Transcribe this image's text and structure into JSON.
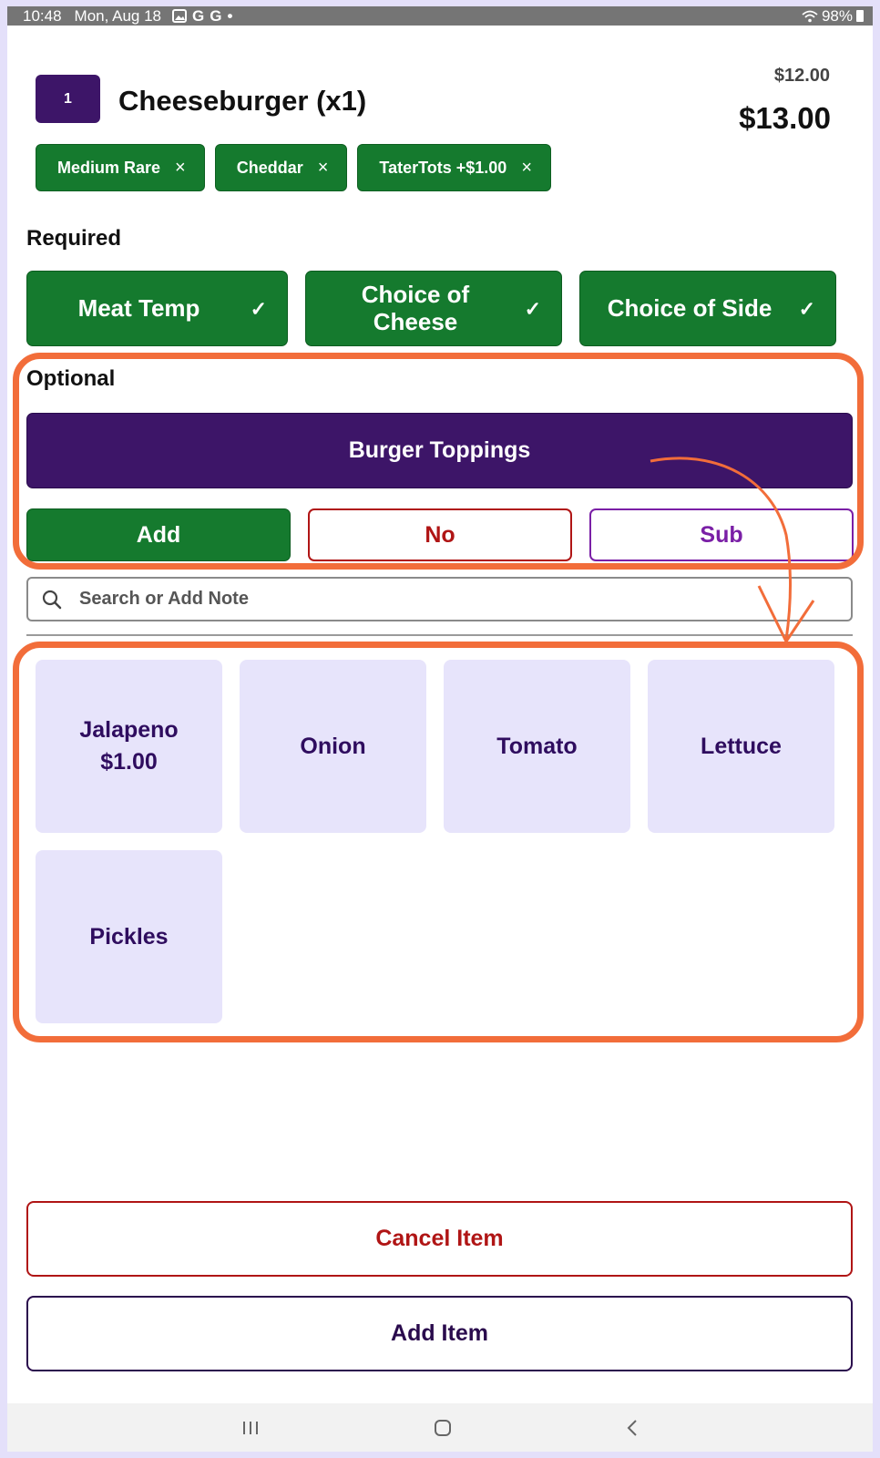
{
  "status_bar": {
    "time": "10:48",
    "date": "Mon, Aug 18",
    "icons": [
      "image-icon",
      "google-icon",
      "google-icon"
    ],
    "dot": "•",
    "battery": "98%"
  },
  "header": {
    "quantity": "1",
    "item_title": "Cheeseburger (x1)",
    "base_price": "$12.00",
    "total_price": "$13.00"
  },
  "selected_modifiers": [
    {
      "label": "Medium Rare",
      "remove": "×"
    },
    {
      "label": "Cheddar",
      "remove": "×"
    },
    {
      "label": "TaterTots +$1.00",
      "remove": "×"
    }
  ],
  "required": {
    "label": "Required",
    "groups": [
      {
        "label": "Meat Temp",
        "check": "✓"
      },
      {
        "label": "Choice of\nCheese",
        "check": "✓"
      },
      {
        "label": "Choice of Side",
        "check": "✓"
      }
    ]
  },
  "optional": {
    "label": "Optional",
    "group": "Burger Toppings",
    "modes": {
      "add": "Add",
      "no": "No",
      "sub": "Sub"
    }
  },
  "search": {
    "placeholder": "Search or Add Note"
  },
  "options": [
    {
      "label": "Jalapeno\n$1.00"
    },
    {
      "label": "Onion"
    },
    {
      "label": "Tomato"
    },
    {
      "label": "Lettuce"
    },
    {
      "label": "Pickles"
    }
  ],
  "actions": {
    "cancel": "Cancel Item",
    "add": "Add Item"
  },
  "colors": {
    "green": "#157a2e",
    "purple": "#3d1568",
    "red": "#b01515",
    "sub_purple": "#7a1fa6",
    "tile": "#e7e4fb",
    "annotation": "#f26d3a"
  }
}
